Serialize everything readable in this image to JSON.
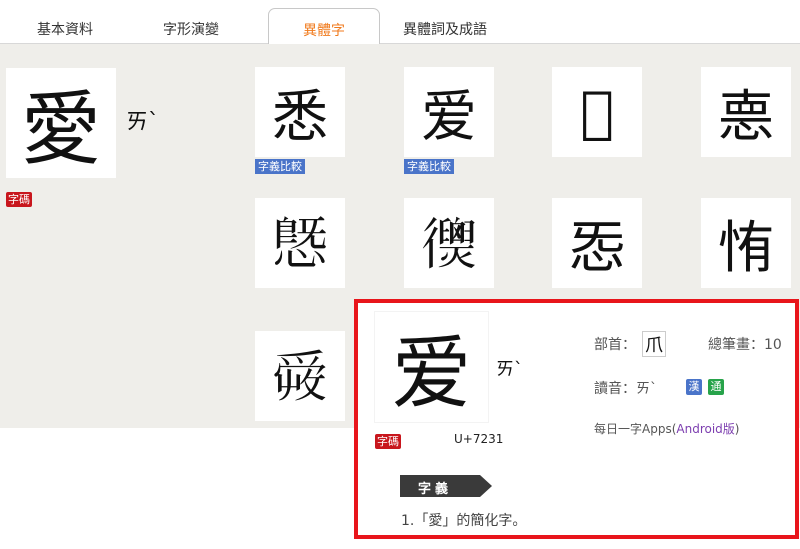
{
  "tabs": [
    {
      "label": "基本資料",
      "active": false
    },
    {
      "label": "字形演變",
      "active": false
    },
    {
      "label": "異體字",
      "active": true
    },
    {
      "label": "異體詞及成語",
      "active": false
    }
  ],
  "main": {
    "char": "愛",
    "bopomofo": "ㄞˋ",
    "code_badge": "字碼"
  },
  "variants": [
    {
      "char": "悉",
      "compare_label": "字義比較"
    },
    {
      "char": "爱",
      "compare_label": "字義比較"
    },
    {
      "char": "𢙣",
      "compare_label": ""
    },
    {
      "char": "𢛳",
      "compare_label": ""
    },
    {
      "char": "𢟪",
      "compare_label": ""
    },
    {
      "char": "𢖣",
      "compare_label": ""
    },
    {
      "char": "㤅",
      "compare_label": ""
    },
    {
      "char": "㤢",
      "compare_label": ""
    },
    {
      "char": "𤔠",
      "compare_label": ""
    }
  ],
  "popup": {
    "char": "爱",
    "bopomofo": "ㄞˋ",
    "code_badge": "字碼",
    "unicode": "U+7231",
    "radical_label": "部首：",
    "radical": "爪",
    "strokes_label": "總筆畫：10",
    "reading_label": "讀音：ㄞˋ",
    "badge_han": "漢",
    "badge_tong": "通",
    "apps_prefix": "每日一字Apps(",
    "apps_link": "Android版",
    "apps_suffix": ")",
    "meaning_tag": "字義",
    "meaning_text": "1.「愛」的簡化字。"
  },
  "colors": {
    "active_tab": "#f07a1c",
    "highlight_border": "#e8151b",
    "red_badge": "#c8161d",
    "blue_badge": "#4a74c9",
    "green_badge": "#27a34a"
  }
}
